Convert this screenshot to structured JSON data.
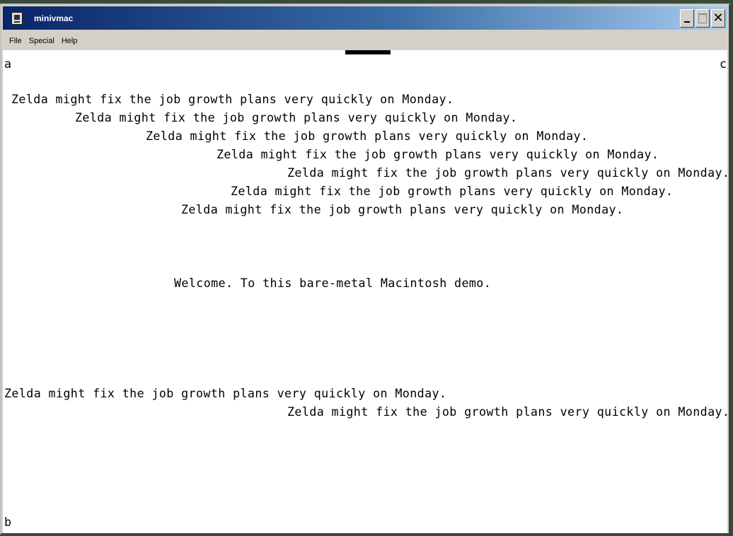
{
  "window": {
    "title": "minivmac",
    "minimize_label": "",
    "maximize_label": "",
    "close_label": "✕"
  },
  "menu": {
    "items": [
      "File",
      "Special",
      "Help"
    ]
  },
  "screen": {
    "corner_a": "a",
    "corner_b": "b",
    "corner_c": "c",
    "pangram_lines": [
      "Zelda might fix the job growth plans very quickly on Monday.",
      "Zelda might fix the job growth plans very quickly on Monday.",
      "Zelda might fix the job growth plans very quickly on Monday.",
      "Zelda might fix the job growth plans very quickly on Monday.",
      "Zelda might fix the job growth plans very quickly on Monday.",
      "Zelda might fix the job growth plans very quickly on Monday.",
      "Zelda might fix the job growth plans very quickly on Monday."
    ],
    "welcome": "Welcome. To this bare-metal Macintosh demo.",
    "bottom_lines": [
      "Zelda might fix the job growth plans very quickly on Monday.",
      "Zelda might fix the job growth plans very quickly on Monday."
    ]
  }
}
